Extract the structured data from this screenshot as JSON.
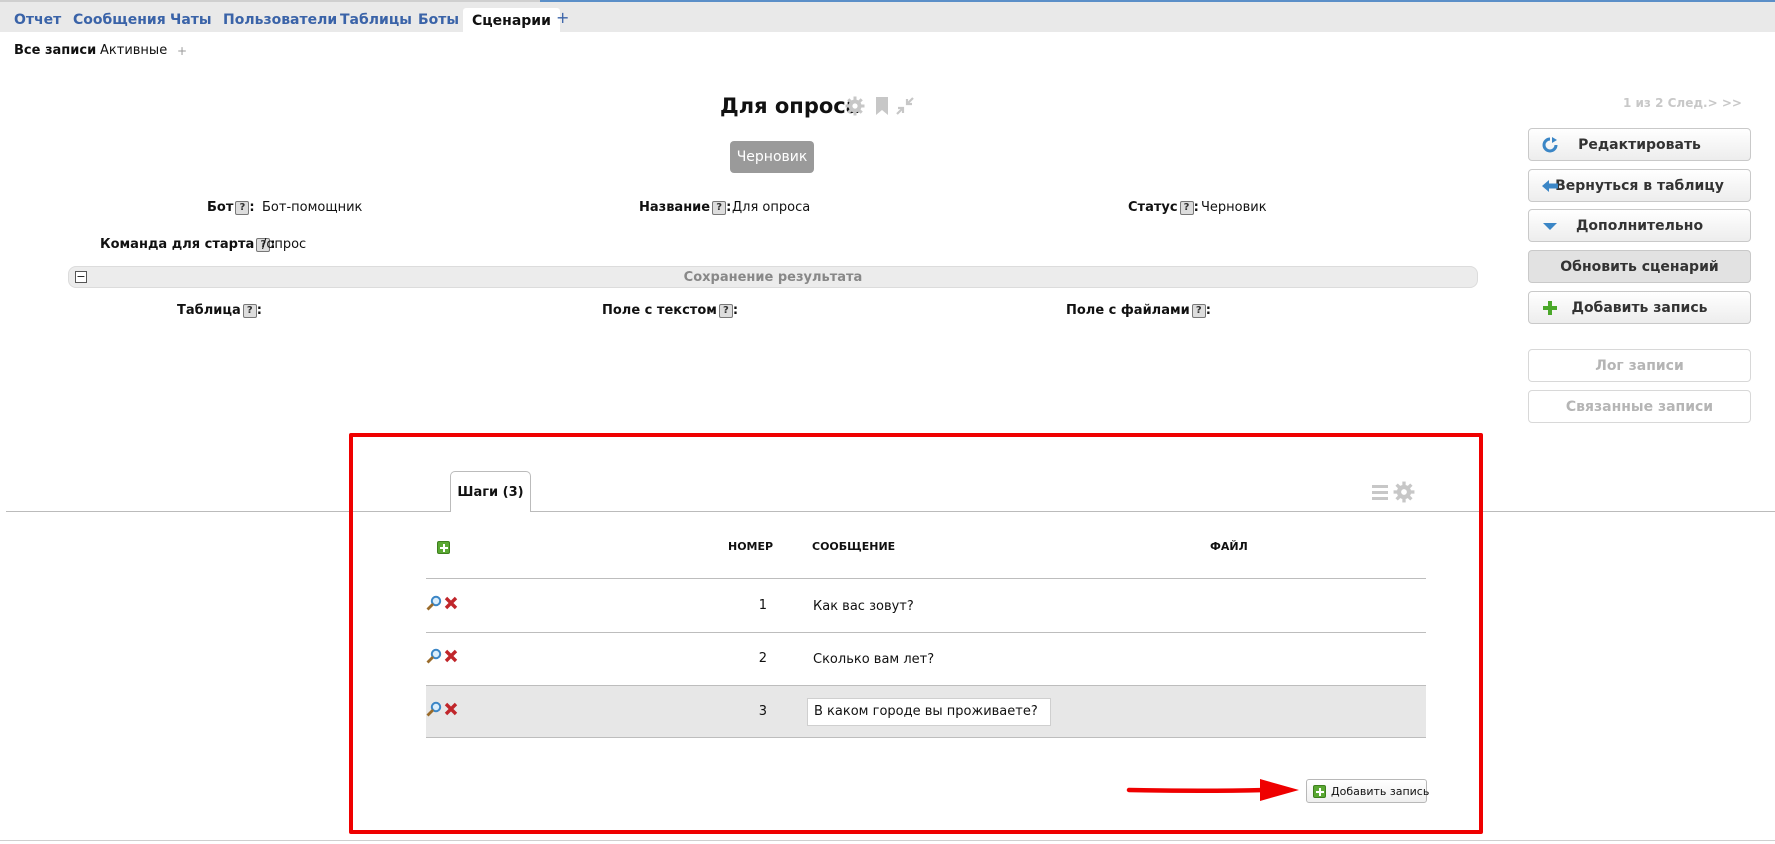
{
  "top_tabs": [
    {
      "label": "Отчет"
    },
    {
      "label": "Сообщения"
    },
    {
      "label": "Чаты"
    },
    {
      "label": "Пользователи"
    },
    {
      "label": "Таблицы"
    },
    {
      "label": "Боты"
    },
    {
      "label": "Сценарии"
    }
  ],
  "top_tabs_add": "+",
  "active_tab": "Сценарии",
  "sub_tabs": [
    {
      "label": "Все записи"
    },
    {
      "label": "Активные"
    }
  ],
  "sub_tabs_add": "+",
  "record": {
    "title": "Для опроса",
    "status_label": "Черновик",
    "pager": "1 из 2 След.> >>"
  },
  "help_glyph": "?",
  "fields": {
    "bot_label": "Бот",
    "bot_value": "Бот-помощник",
    "name_label": "Название",
    "name_value": "Для опроса",
    "status_label": "Статус",
    "status_value": "Черновик",
    "command_label": "Команда для старта",
    "command_value": "/опрос",
    "table_label": "Таблица",
    "text_field_label": "Поле с текстом",
    "files_field_label": "Поле с файлами",
    "colon": ":"
  },
  "section": {
    "collapse_glyph": "−",
    "title": "Сохранение результата"
  },
  "actions": {
    "edit": "Редактировать",
    "back_to_table": "Вернуться в таблицу",
    "more": "Дополнительно",
    "update_scenario": "Обновить сценарий",
    "add_record": "Добавить запись",
    "record_log": "Лог записи",
    "linked_records": "Связанные записи"
  },
  "steps": {
    "tab_label": "Шаги (3)",
    "columns": {
      "number": "НОМЕР",
      "message": "СООБЩЕНИЕ",
      "file": "ФАЙЛ"
    },
    "rows": [
      {
        "number": "1",
        "message": "Как вас зовут?"
      },
      {
        "number": "2",
        "message": "Сколько вам лет?"
      },
      {
        "number": "3",
        "message": "В каком городе вы проживаете?"
      }
    ],
    "add_button": "Добавить запись"
  },
  "colors": {
    "link": "#3a63a8",
    "highlight_frame": "#ef0000",
    "status_badge": "#9a9a9a",
    "add_green": "#5aa832",
    "delete_red": "#c0262b"
  }
}
